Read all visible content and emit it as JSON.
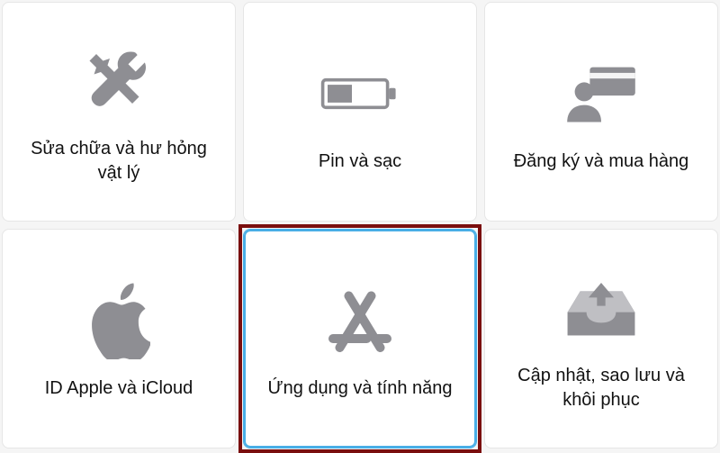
{
  "cards": [
    {
      "icon": "tools",
      "label": "Sửa chữa và hư hỏng vật lý",
      "selected": false
    },
    {
      "icon": "battery",
      "label": "Pin và sạc",
      "selected": false
    },
    {
      "icon": "subscribe",
      "label": "Đăng ký và mua hàng",
      "selected": false
    },
    {
      "icon": "apple",
      "label": "ID Apple và iCloud",
      "selected": false
    },
    {
      "icon": "appstore",
      "label": "Ứng dụng và tính năng",
      "selected": true
    },
    {
      "icon": "download",
      "label": "Cập nhật, sao lưu và khôi phục",
      "selected": false
    }
  ],
  "icon_fill": "#8e8e93"
}
